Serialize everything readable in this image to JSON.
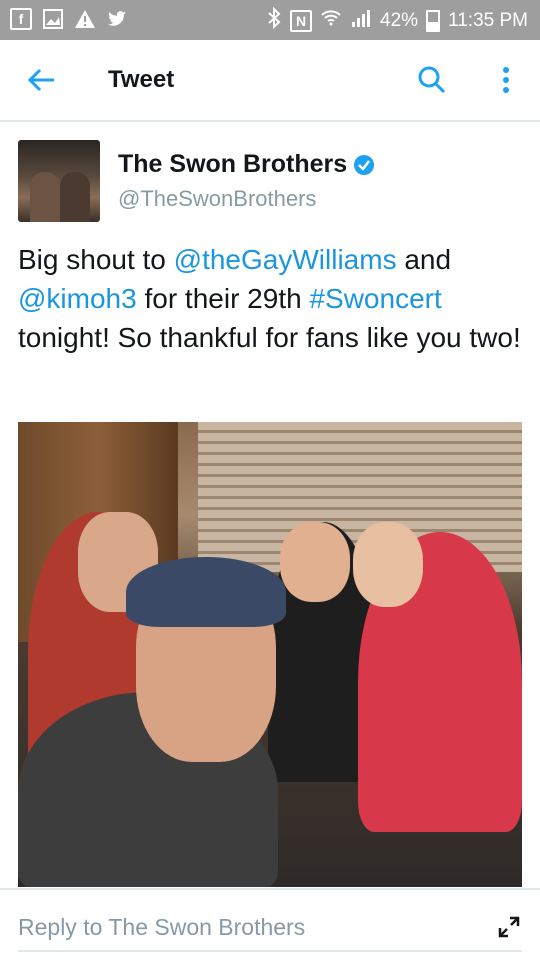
{
  "status_bar": {
    "battery": "42%",
    "battery_fraction": 0.42,
    "time": "11:35 PM",
    "left_icons": [
      "facebook-icon",
      "gallery-icon",
      "alert-icon",
      "twitter-icon"
    ],
    "right_icons": [
      "bluetooth-icon",
      "nfc-icon",
      "wifi-icon",
      "signal-icon",
      "battery-icon"
    ]
  },
  "app_bar": {
    "title": "Tweet"
  },
  "tweet": {
    "display_name": "The Swon Brothers",
    "handle": "@TheSwonBrothers",
    "verified": true,
    "text_parts": [
      {
        "text": "Big shout to ",
        "type": "plain"
      },
      {
        "text": "@theGayWilliams",
        "type": "mention"
      },
      {
        "text": " and ",
        "type": "plain"
      },
      {
        "text": "@kimoh3",
        "type": "mention"
      },
      {
        "text": " for their 29th ",
        "type": "plain"
      },
      {
        "text": "#Swoncert",
        "type": "hashtag"
      },
      {
        "text": " tonight! So thankful for fans like you two!",
        "type": "plain"
      }
    ]
  },
  "reply_bar": {
    "placeholder": "Reply to The Swon Brothers"
  },
  "colors": {
    "link": "#1b95e0",
    "accent": "#1da1f2",
    "secondary_text": "#8899a6",
    "status_bar": "#9e9e9e"
  }
}
